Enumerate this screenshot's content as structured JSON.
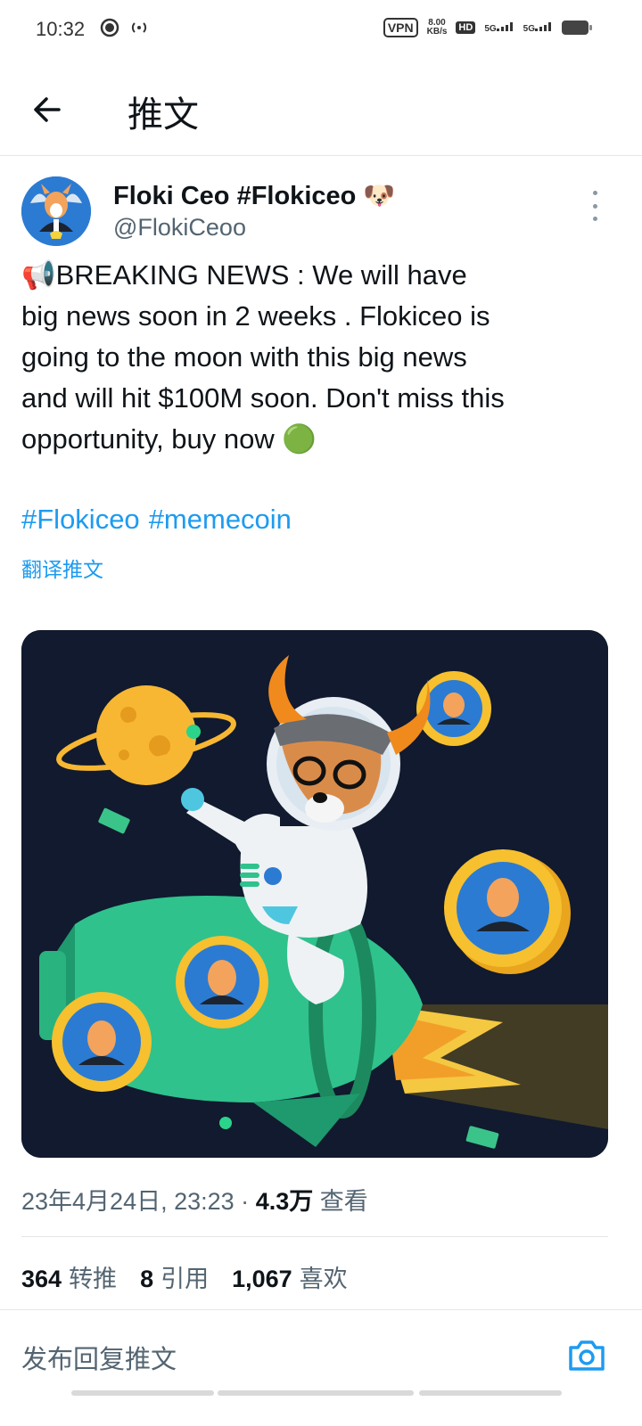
{
  "status_bar": {
    "time": "10:32",
    "vpn": "VPN",
    "speed_value": "8.00",
    "speed_unit": "KB/s",
    "hd": "HD",
    "sim1": "5G",
    "sim2": "5G"
  },
  "header": {
    "title": "推文"
  },
  "tweet": {
    "author_name": "Floki Ceo #Flokiceo 🐶",
    "author_handle": "@FlokiCeoo",
    "text": "📢BREAKING NEWS : We will have\nbig news soon in 2 weeks . Flokiceo is\ngoing to the moon with this big news\nand will hit $100M soon. Don't miss this\nopportunity, buy now 🟢",
    "hashtags": [
      "#Flokiceo",
      "#memecoin"
    ],
    "translate": "翻译推文",
    "timestamp": "23年4月24日, 23:23",
    "separator": "·",
    "views": "4.3万",
    "views_label": "查看",
    "retweets": "364",
    "retweets_label": "转推",
    "quotes": "8",
    "quotes_label": "引用",
    "likes": "1,067",
    "likes_label": "喜欢"
  },
  "reply": {
    "placeholder": "发布回复推文"
  },
  "colors": {
    "link": "#1d9bf0",
    "muted": "#536471",
    "media_bg": "#111a2e"
  }
}
